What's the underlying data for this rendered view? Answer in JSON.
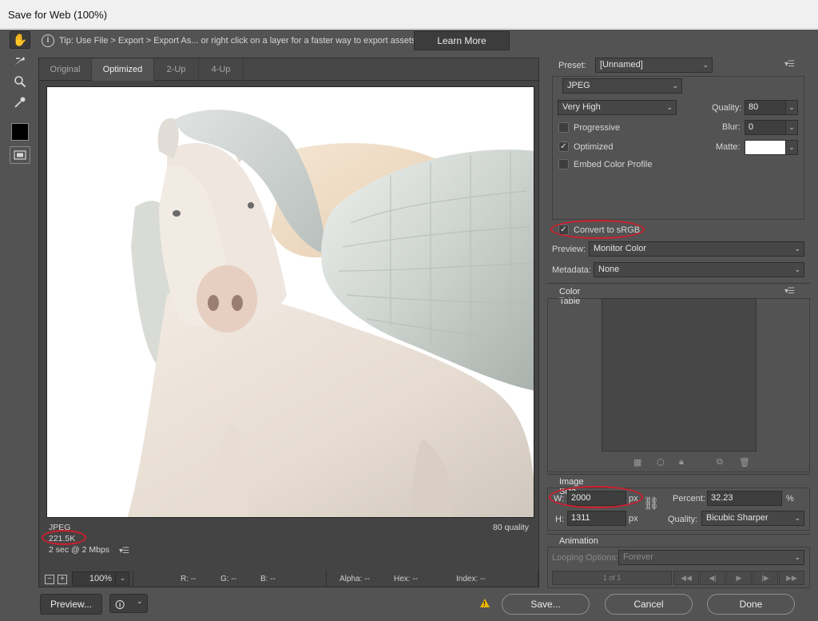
{
  "window": {
    "title": "Save for Web (100%)"
  },
  "tip": {
    "text": "Tip: Use File > Export > Export As... or right click on a layer for a faster way to export assets",
    "learn_more": "Learn More"
  },
  "tabs": [
    {
      "label": "Original",
      "active": false
    },
    {
      "label": "Optimized",
      "active": true
    },
    {
      "label": "2-Up",
      "active": false
    },
    {
      "label": "4-Up",
      "active": false
    }
  ],
  "preview_info": {
    "format": "JPEG",
    "size": "221.5K",
    "time": "2 sec @ 2 Mbps",
    "quality": "80 quality"
  },
  "status": {
    "zoom": "100%",
    "r": "R: --",
    "g": "G: --",
    "b": "B: --",
    "alpha": "Alpha: --",
    "hex": "Hex: --",
    "index": "Index: --"
  },
  "buttons": {
    "preview": "Preview...",
    "save": "Save...",
    "cancel": "Cancel",
    "done": "Done"
  },
  "settings": {
    "preset_label": "Preset:",
    "preset_value": "[Unnamed]",
    "format": "JPEG",
    "quality_preset": "Very High",
    "quality_label": "Quality:",
    "quality_value": "80",
    "blur_label": "Blur:",
    "blur_value": "0",
    "matte_label": "Matte:",
    "progressive": {
      "label": "Progressive",
      "checked": false
    },
    "optimized": {
      "label": "Optimized",
      "checked": true
    },
    "embed_profile": {
      "label": "Embed Color Profile",
      "checked": false
    },
    "convert_srgb": {
      "label": "Convert to sRGB",
      "checked": true
    },
    "preview_label": "Preview:",
    "preview_value": "Monitor Color",
    "metadata_label": "Metadata:",
    "metadata_value": "None"
  },
  "color_table": {
    "title": "Color Table"
  },
  "image_size": {
    "title": "Image Size",
    "w_label": "W:",
    "w_value": "2000",
    "h_label": "H:",
    "h_value": "1311",
    "unit": "px",
    "percent_label": "Percent:",
    "percent_value": "32.23",
    "percent_unit": "%",
    "quality_label": "Quality:",
    "quality_value": "Bicubic Sharper"
  },
  "animation": {
    "title": "Animation",
    "looping_label": "Looping Options:",
    "looping_value": "Forever",
    "frame_counter": "1 of 1"
  },
  "colors": {
    "dialog_bg": "#535353",
    "highlight_oval": "#d01e2e",
    "warning": "#e8b400"
  }
}
